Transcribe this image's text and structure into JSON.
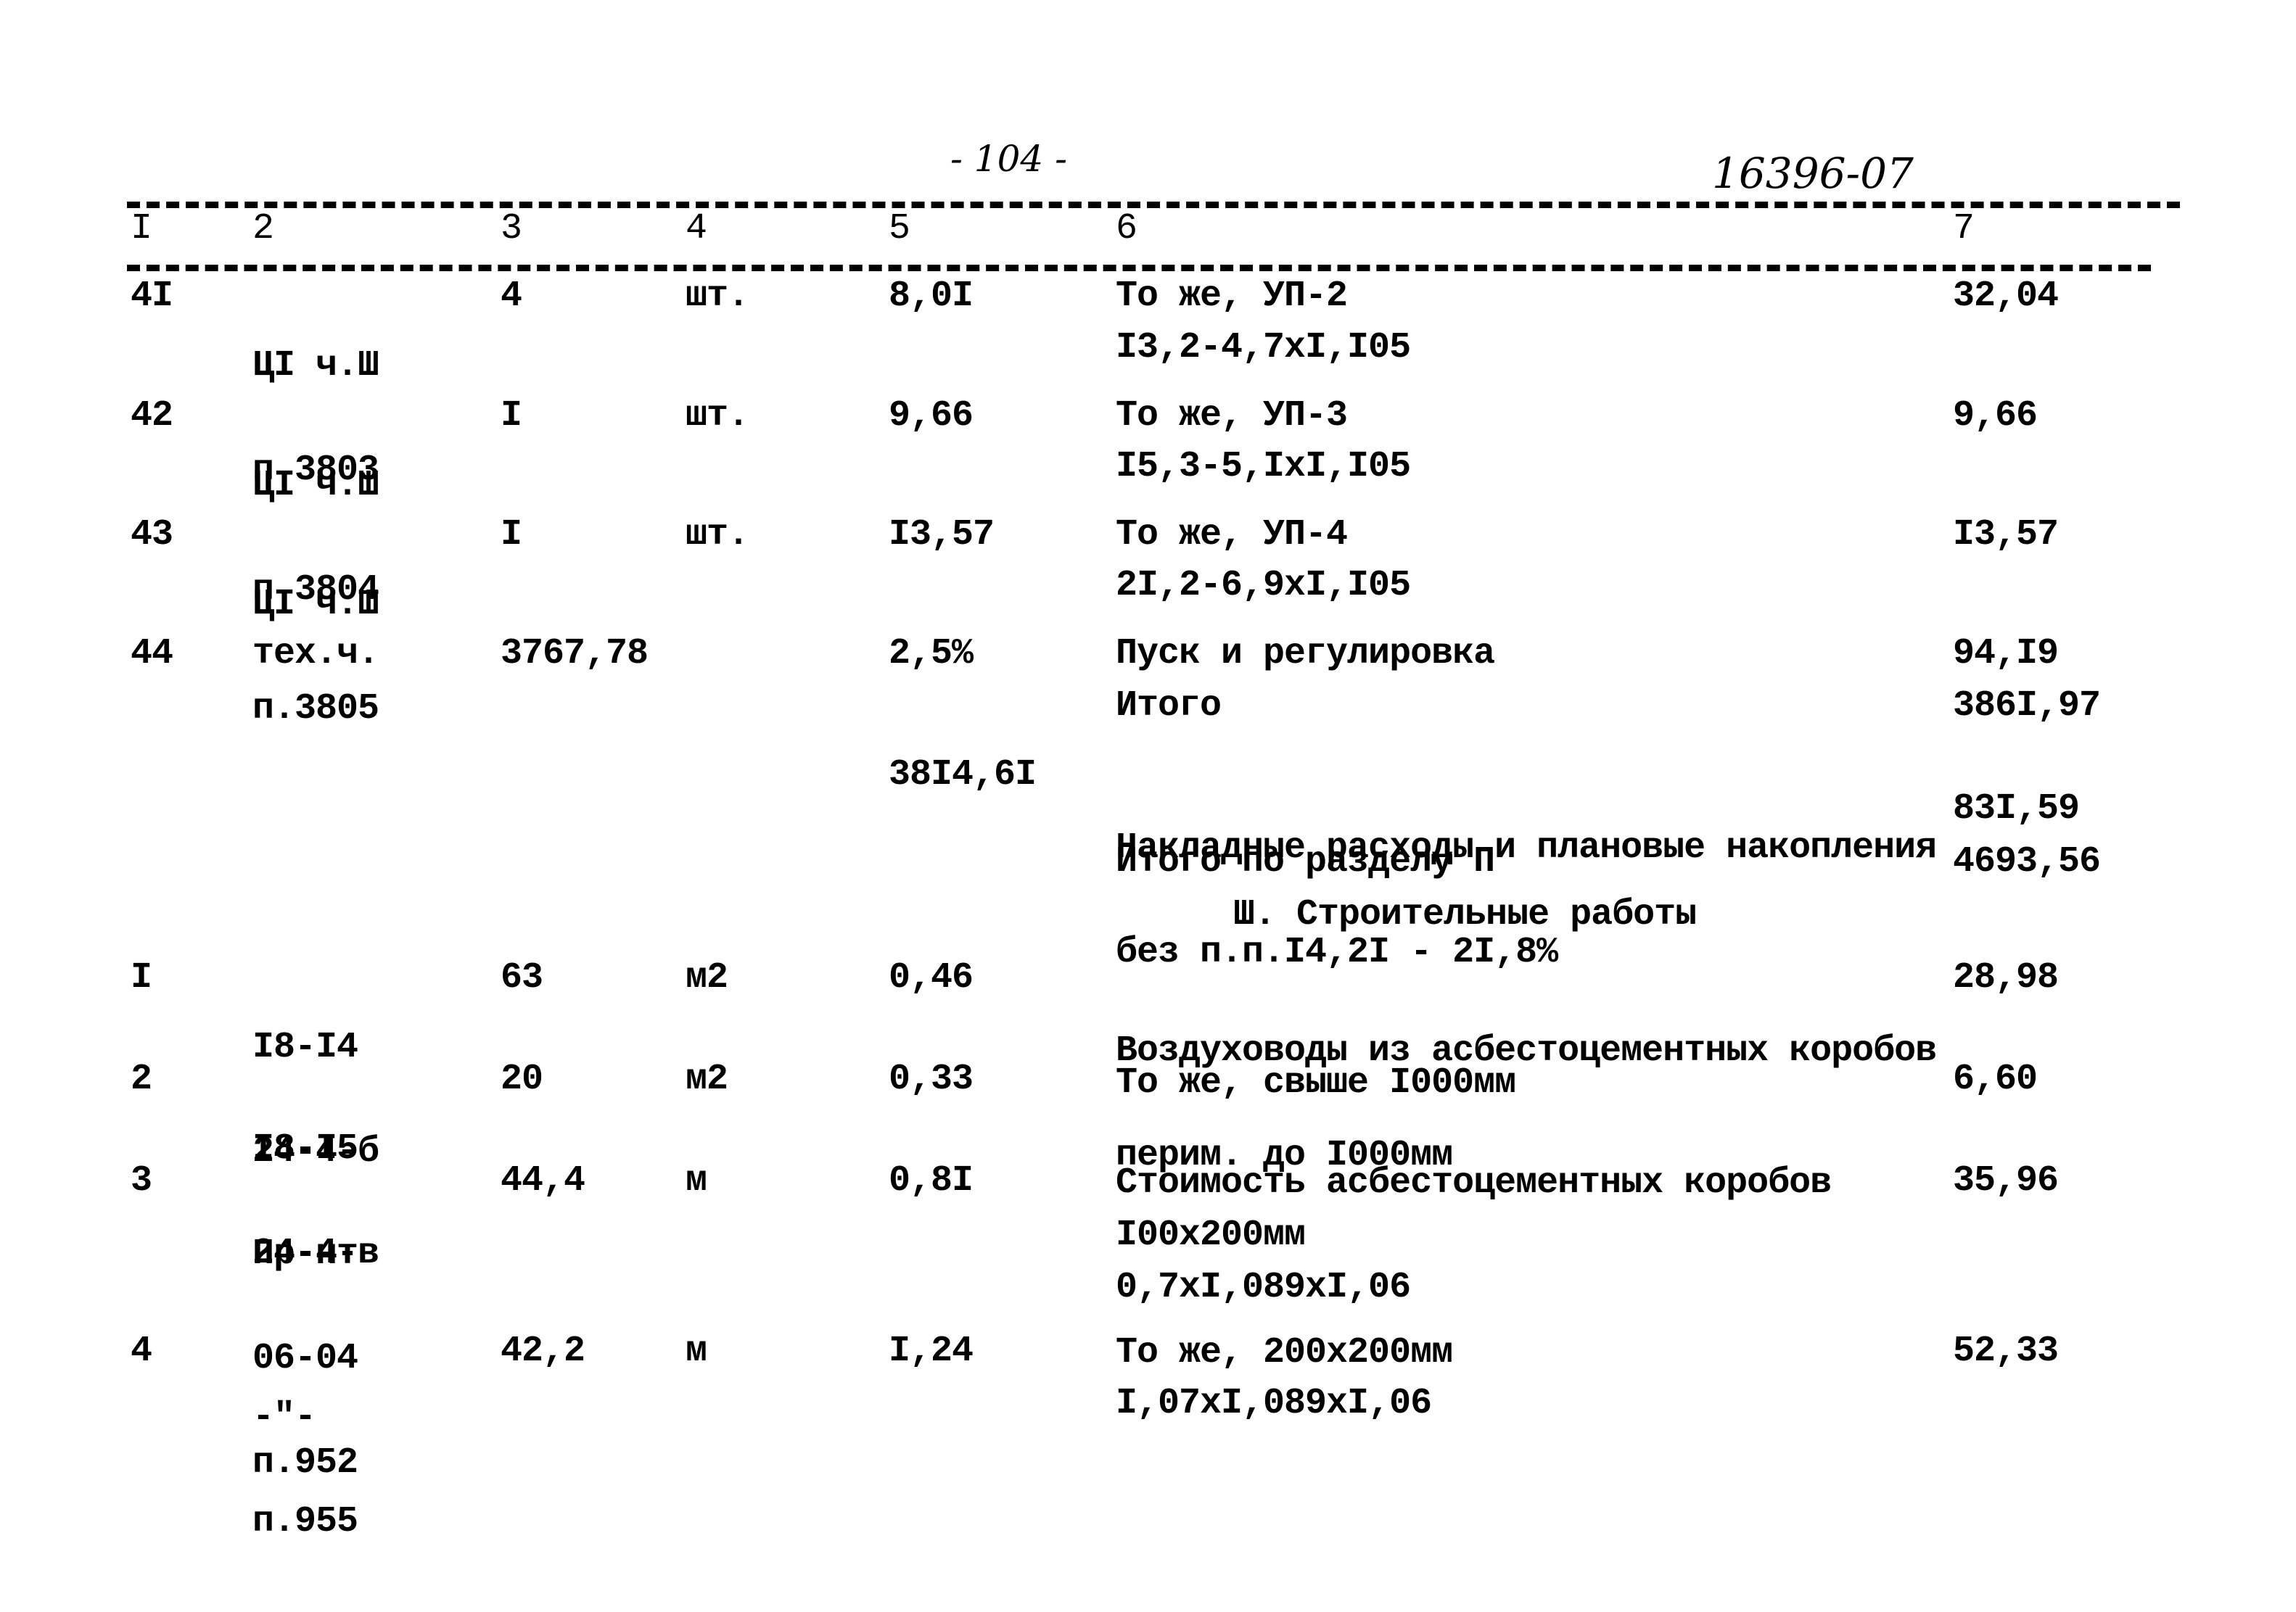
{
  "page_number": "- 104 -",
  "document_number": "16396-07",
  "columns": [
    "I",
    "2",
    "3",
    "4",
    "5",
    "6",
    "7"
  ],
  "rows": [
    {
      "num": "4I",
      "code": [
        "ЦI ч.Ш",
        "п.3803"
      ],
      "qty": "4",
      "unit": "шт.",
      "price": "8,0I",
      "desc": [
        "То же, УП-2",
        "I3,2-4,7хI,I05"
      ],
      "total": "32,04"
    },
    {
      "num": "42",
      "code": [
        "ЦI ч.Ш",
        "п.3804"
      ],
      "qty": "I",
      "unit": "шт.",
      "price": "9,66",
      "desc": [
        "То же, УП-3",
        "I5,3-5,IхI,I05"
      ],
      "total": "9,66"
    },
    {
      "num": "43",
      "code": [
        "ЦI ч.Ш",
        "п.3805"
      ],
      "qty": "I",
      "unit": "шт.",
      "price": "I3,57",
      "desc": [
        "То же, УП-4",
        "2I,2-6,9хI,I05"
      ],
      "total": "I3,57"
    },
    {
      "num": "44",
      "code": [
        "тех.ч."
      ],
      "qty": "3767,78",
      "unit": "",
      "price": "2,5%",
      "desc": [
        "Пуск и регулировка"
      ],
      "total": "94,I9"
    }
  ],
  "subtotal": {
    "label": "Итого",
    "value": "386I,97"
  },
  "overhead": {
    "base": "38I4,6I",
    "desc": [
      "Накладные расходы и плановые накопления",
      "без п.п.I4,2I - 2I,8%"
    ],
    "value": "83I,59"
  },
  "section_total": {
    "label": "Итого по разделу П",
    "value": "4693,56"
  },
  "section_heading": "Ш. Строительные работы",
  "rows2": [
    {
      "num": "I",
      "code": [
        "I8-I4",
        "24-4-б"
      ],
      "qty": "63",
      "unit": "м2",
      "price": "0,46",
      "desc": [
        "Воздуховоды из асбестоцементных коробов",
        "перим. до I000мм"
      ],
      "total": "28,98"
    },
    {
      "num": "2",
      "code": [
        "I8-I5",
        "24-4-в"
      ],
      "qty": "20",
      "unit": "м2",
      "price": "0,33",
      "desc": [
        "То же, свыше I000мм"
      ],
      "total": "6,60"
    },
    {
      "num": "3",
      "code": [
        "Пр-нт",
        "06-04",
        "п.952"
      ],
      "qty": "44,4",
      "unit": "м",
      "price": "0,8I",
      "desc": [
        "Стоимость асбестоцементных коробов",
        "I00х200мм",
        "0,7хI,089хI,06"
      ],
      "total": "35,96"
    },
    {
      "num": "4",
      "code": [
        "-\"-",
        "п.955"
      ],
      "qty": "42,2",
      "unit": "м",
      "price": "I,24",
      "desc": [
        "То же, 200х200мм",
        "I,07хI,089хI,06"
      ],
      "total": "52,33"
    }
  ]
}
